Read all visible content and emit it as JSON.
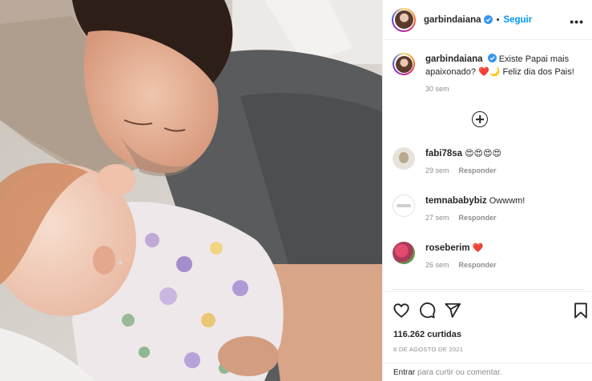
{
  "post": {
    "username": "garbindaiana",
    "follow_label": "Seguir",
    "dot": "•",
    "more_label": "•••"
  },
  "caption": {
    "username": "garbindaiana",
    "text": "Existe Papai mais apaixonado? ❤️🌙 Feliz dia dos Pais!",
    "time": "30 sem"
  },
  "comments": [
    {
      "username": "fabi78sa",
      "text": "😍😍😍😍",
      "time": "29 sem",
      "reply": "Responder"
    },
    {
      "username": "temnababybiz",
      "text": "Owwwm!",
      "time": "27 sem",
      "reply": "Responder"
    },
    {
      "username": "roseberim",
      "text": "❤️",
      "time": "26 sem",
      "reply": "Responder"
    }
  ],
  "stats": {
    "likes": "116.262 curtidas",
    "date": "8 DE AGOSTO DE 2021"
  },
  "login": {
    "link": "Entrar",
    "rest": "para curtir ou comentar."
  },
  "icons": {
    "like": "heart-icon",
    "comment": "comment-icon",
    "share": "share-icon",
    "save": "bookmark-icon",
    "load_more": "plus-circle-icon",
    "verified": "verified-badge-icon"
  },
  "colors": {
    "follow_blue": "#0095f6",
    "verified_blue": "#3897f0",
    "muted": "#8e8e8e"
  }
}
